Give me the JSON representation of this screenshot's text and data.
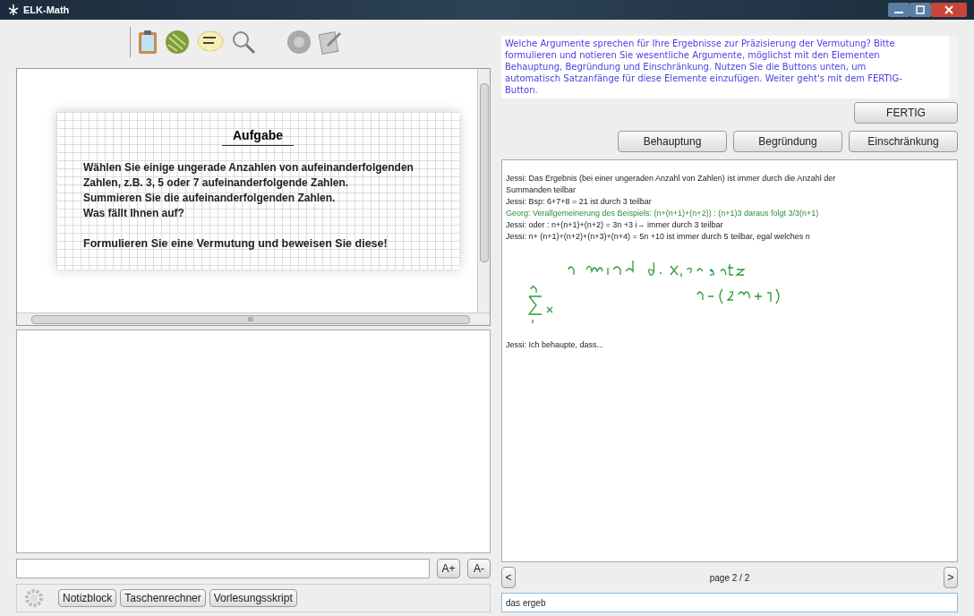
{
  "window": {
    "title": "ELK-Math"
  },
  "task": {
    "title": "Aufgabe",
    "lines": [
      "Wählen Sie einige ungerade Anzahlen von aufeinanderfolgenden",
      "Zahlen, z.B. 3, 5 oder 7 aufeinanderfolgende Zahlen.",
      "Summieren Sie die aufeinanderfolgenden Zahlen.",
      "Was fällt Ihnen auf?"
    ],
    "closing": "Formulieren Sie eine Vermutung und beweisen Sie diese!",
    "scroll_mark": "III"
  },
  "font_buttons": [
    "A+",
    "A-"
  ],
  "tools": [
    {
      "label": "Notizblock"
    },
    {
      "label": "Taschenrechner"
    },
    {
      "label": "Vorlesungsskript"
    }
  ],
  "instruction": "Welche Argumente sprechen für Ihre Ergebnisse zur Präzisierung der Vermutung? Bitte formulieren und notieren Sie wesentliche Argumente, möglichst mit den Elementen Behauptung, Begründung und Einschränkung. Nutzen Sie die Buttons unten, um automatisch Satzanfänge für diese Elemente einzufügen. Weiter geht's mit dem FERTIG-Button.",
  "done_button": "FERTIG",
  "element_buttons": [
    "Behauptung",
    "Begründung",
    "Einschränkung"
  ],
  "messages": [
    {
      "text": "Jessi: Das Ergebnis (bei einer ungeraden Anzahl von Zahlen) ist immer durch die Anzahl der Summanden teilbar",
      "kind": "plain"
    },
    {
      "text": "Jessi: Bsp: 6+7+8 = 21  ist durch 3 teilbar",
      "kind": "plain"
    },
    {
      "text": "Georg: Verallgemeinerung des Beispiels: (n+(n+1)+(n+2)) : (n+1)3 daraus folgt 3/3(n+1)",
      "kind": "highlighted"
    },
    {
      "text": "Jessi: oder : n+(n+1)+(n+2) = 3n +3 i→ immer durch 3 teilbar",
      "kind": "plain"
    },
    {
      "text": "Jessi: n+ (n+1)+(n+2)+(n+3)+(n+4) =  5n +10 ist immer durch 5 teilbar, egal welches n",
      "kind": "plain"
    }
  ],
  "last_message": "Jessi: Ich behaupte, dass...",
  "pager": {
    "prev": "<",
    "label": "page 2 / 2",
    "next": ">"
  },
  "chat_input": {
    "value": "das ergeb"
  }
}
